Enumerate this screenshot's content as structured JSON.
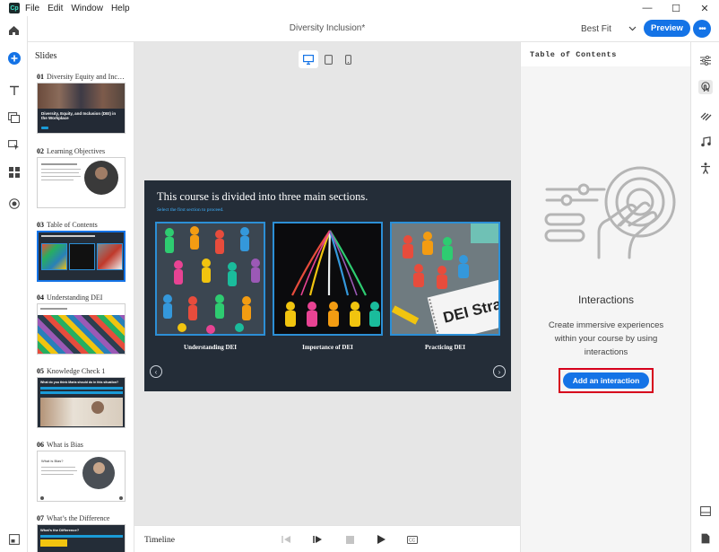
{
  "menubar": {
    "app_icon": "Cp",
    "items": [
      "File",
      "Edit",
      "Window",
      "Help"
    ],
    "window_controls": {
      "minimize": "—",
      "maximize": "☐",
      "close": "✕"
    }
  },
  "appbar": {
    "document_title": "Diversity Inclusion*",
    "fit_select": "Best Fit",
    "preview_label": "Preview",
    "more_label": "•••"
  },
  "slides_panel": {
    "title": "Slides",
    "items": [
      {
        "number": "01",
        "title": "Diversity Equity and Inclu...",
        "thumb_caption": "Diversity, Equity, and Inclusion (DEI) in the Workplace"
      },
      {
        "number": "02",
        "title": "Learning Objectives"
      },
      {
        "number": "03",
        "title": "Table of Contents",
        "active": true
      },
      {
        "number": "04",
        "title": "Understanding DEI"
      },
      {
        "number": "05",
        "title": "Knowledge Check 1",
        "thumb_caption": "What do you think Maria should do in this situation?"
      },
      {
        "number": "06",
        "title": "What is Bias",
        "thumb_caption": "What is Bias?"
      },
      {
        "number": "07",
        "title": "What’s the Difference",
        "thumb_caption": "What’s the Difference?"
      }
    ]
  },
  "stage": {
    "heading": "This course is divided into three main sections.",
    "subheading": "Select the first section to proceed.",
    "cards": [
      {
        "caption": "Understanding DEI"
      },
      {
        "caption": "Importance of DEI"
      },
      {
        "caption": "Practicing DEI",
        "sign_text": "DEI Strate"
      }
    ],
    "prev_label": "‹",
    "next_label": "›"
  },
  "timeline": {
    "label": "Timeline"
  },
  "right_panel": {
    "title": "Table of Contents",
    "heading": "Interactions",
    "description": "Create immersive experiences within your course by using interactions",
    "add_button_label": "Add an interaction"
  },
  "colors": {
    "accent": "#1473e6",
    "highlight_frame": "#d6001c",
    "stage_bg": "#242d38",
    "card_border": "#2c8fd6"
  }
}
